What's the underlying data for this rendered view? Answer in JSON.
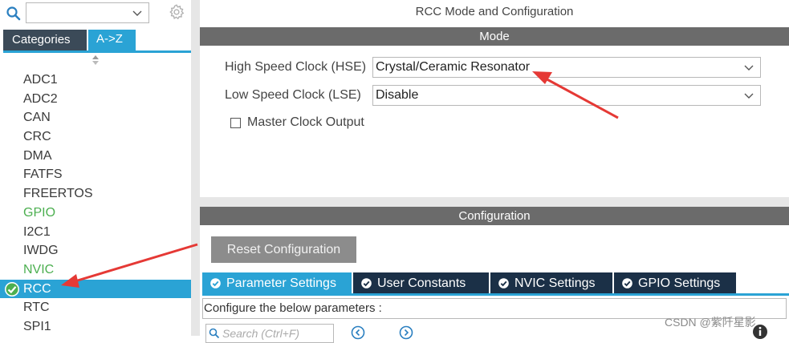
{
  "left_panel": {
    "search_value": "",
    "tabs": {
      "categories": "Categories",
      "az": "A->Z"
    },
    "items": [
      {
        "label": "ADC1",
        "status": "normal"
      },
      {
        "label": "ADC2",
        "status": "normal"
      },
      {
        "label": "CAN",
        "status": "normal"
      },
      {
        "label": "CRC",
        "status": "normal"
      },
      {
        "label": "DMA",
        "status": "normal"
      },
      {
        "label": "FATFS",
        "status": "normal"
      },
      {
        "label": "FREERTOS",
        "status": "normal"
      },
      {
        "label": "GPIO",
        "status": "configured"
      },
      {
        "label": "I2C1",
        "status": "normal"
      },
      {
        "label": "IWDG",
        "status": "normal"
      },
      {
        "label": "NVIC",
        "status": "configured"
      },
      {
        "label": "RCC",
        "status": "selected"
      },
      {
        "label": "RTC",
        "status": "normal"
      },
      {
        "label": "SPI1",
        "status": "normal"
      }
    ]
  },
  "right_panel": {
    "title": "RCC Mode and Configuration",
    "mode_header": "Mode",
    "hse": {
      "label": "High Speed Clock (HSE)",
      "value": "Crystal/Ceramic Resonator"
    },
    "lse": {
      "label": "Low Speed Clock (LSE)",
      "value": "Disable"
    },
    "mco": {
      "label": "Master Clock Output",
      "checked": false
    },
    "config_header": "Configuration",
    "reset_button": "Reset Configuration",
    "config_tabs": [
      "Parameter Settings",
      "User Constants",
      "NVIC Settings",
      "GPIO Settings"
    ],
    "params_text": "Configure the below parameters :",
    "search_placeholder": "Search (Ctrl+F)"
  },
  "watermark": "CSDN @紫阡星影",
  "colors": {
    "accent": "#2aa3d5",
    "dark_tab": "#1b3047",
    "section_bar": "#6b6b6b",
    "configured": "#4caf50",
    "annotation_arrow": "#e53935"
  },
  "icons": [
    "search-icon",
    "gear-icon",
    "chevron-down-icon",
    "sort-arrow-icon",
    "check-circle-icon",
    "info-icon",
    "prev-icon",
    "next-icon"
  ]
}
